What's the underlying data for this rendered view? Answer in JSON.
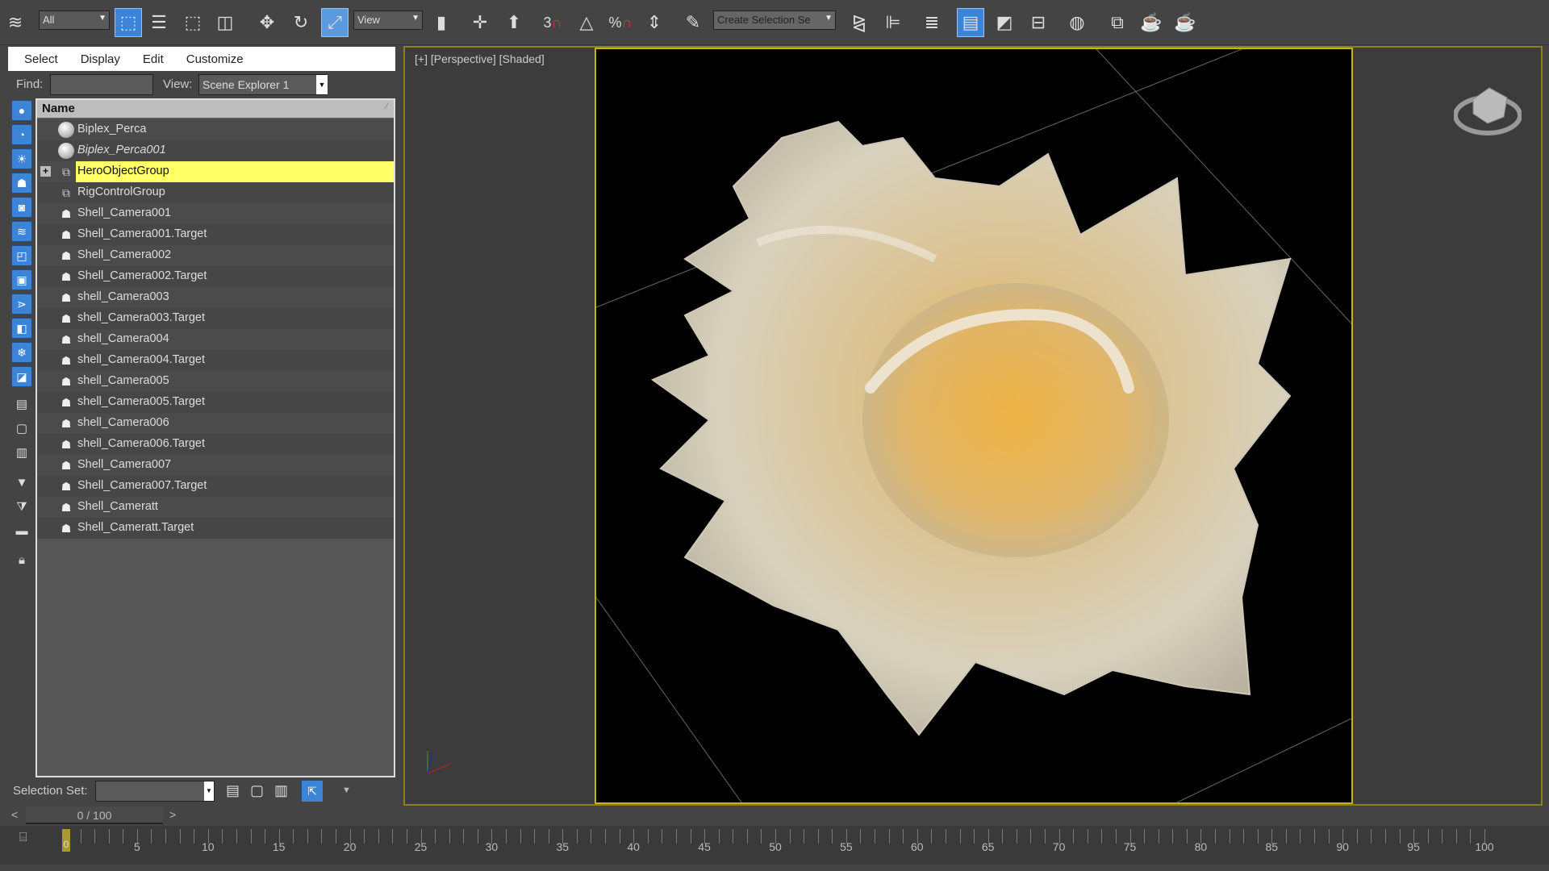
{
  "toolbar": {
    "selection_filter": "All",
    "ref_coord": "View",
    "named_selection_placeholder": "Create Selection Se",
    "snap_3": "3",
    "percent": "%"
  },
  "explorer": {
    "menu": [
      "Select",
      "Display",
      "Edit",
      "Customize"
    ],
    "find_label": "Find:",
    "find_value": "",
    "view_label": "View:",
    "view_value": "Scene Explorer 1",
    "column_header": "Name",
    "rows": [
      {
        "name": "Biplex_Perca",
        "type": "sphere"
      },
      {
        "name": "Biplex_Perca001",
        "type": "sphere",
        "italic": true
      },
      {
        "name": "HeroObjectGroup",
        "type": "group",
        "selected": true,
        "expandable": true
      },
      {
        "name": "RigControlGroup",
        "type": "group"
      },
      {
        "name": "Shell_Camera001",
        "type": "camera"
      },
      {
        "name": "Shell_Camera001.Target",
        "type": "camera"
      },
      {
        "name": "Shell_Camera002",
        "type": "camera"
      },
      {
        "name": "Shell_Camera002.Target",
        "type": "camera"
      },
      {
        "name": "shell_Camera003",
        "type": "camera"
      },
      {
        "name": "shell_Camera003.Target",
        "type": "camera"
      },
      {
        "name": "shell_Camera004",
        "type": "camera"
      },
      {
        "name": "shell_Camera004.Target",
        "type": "camera"
      },
      {
        "name": "shell_Camera005",
        "type": "camera"
      },
      {
        "name": "shell_Camera005.Target",
        "type": "camera"
      },
      {
        "name": "shell_Camera006",
        "type": "camera"
      },
      {
        "name": "shell_Camera006.Target",
        "type": "camera"
      },
      {
        "name": "Shell_Camera007",
        "type": "camera"
      },
      {
        "name": "Shell_Camera007.Target",
        "type": "camera"
      },
      {
        "name": "Shell_Cameratt",
        "type": "camera"
      },
      {
        "name": "Shell_Cameratt.Target",
        "type": "camera"
      }
    ],
    "selection_set_label": "Selection Set:",
    "selection_set_value": ""
  },
  "viewport": {
    "label": "[+] [Perspective] [Shaded]"
  },
  "timeline": {
    "frame_display": "0 / 100",
    "current_frame": 0,
    "start": 0,
    "end": 100,
    "label_step": 5,
    "prev": "<",
    "next": ">"
  },
  "colors": {
    "accent": "#3b84d8",
    "selection": "#ffff66",
    "safe_frame": "#c9b400"
  }
}
